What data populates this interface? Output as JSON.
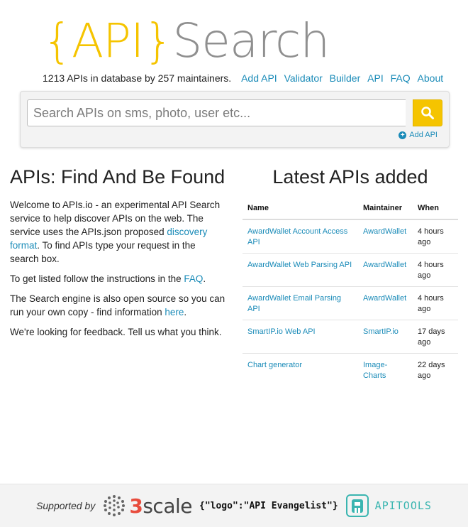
{
  "logo": {
    "brace_text": "{API}",
    "search_text": "Search"
  },
  "stats": {
    "text": "1213 APIs in database by 257 maintainers."
  },
  "nav": [
    {
      "label": "Add API"
    },
    {
      "label": "Validator"
    },
    {
      "label": "Builder"
    },
    {
      "label": "API"
    },
    {
      "label": "FAQ"
    },
    {
      "label": "About"
    }
  ],
  "search": {
    "placeholder": "Search APIs on sms, photo, user etc...",
    "value": "",
    "button_icon": "search-icon",
    "add_api_label": "Add API"
  },
  "intro": {
    "heading": "APIs: Find And Be Found",
    "p1_before": "Welcome to APIs.io - an experimental API Search service to help discover APIs on the web. The service uses the APIs.json proposed ",
    "p1_link": "discovery format",
    "p1_after": ". To find APIs type your request in the search box.",
    "p2_before": "To get listed follow the instructions in the ",
    "p2_link": "FAQ",
    "p2_after": ".",
    "p3_before": "The Search engine is also open source so you can run your own copy - find information ",
    "p3_link": "here",
    "p3_after": ".",
    "p4": "We're looking for feedback. Tell us what you think."
  },
  "latest": {
    "heading": "Latest APIs added",
    "columns": [
      "Name",
      "Maintainer",
      "When"
    ],
    "rows": [
      {
        "name": "AwardWallet Account Access API",
        "maintainer": "AwardWallet",
        "when": "4 hours ago"
      },
      {
        "name": "AwardWallet Web Parsing API",
        "maintainer": "AwardWallet",
        "when": "4 hours ago"
      },
      {
        "name": "AwardWallet Email Parsing API",
        "maintainer": "AwardWallet",
        "when": "4 hours ago"
      },
      {
        "name": "SmartIP.io Web API",
        "maintainer": "SmartIP.io",
        "when": "17 days ago"
      },
      {
        "name": "Chart generator",
        "maintainer": "Image-Charts",
        "when": "22 days ago"
      }
    ]
  },
  "footer": {
    "supported_by": "Supported by",
    "threescale_three": "3",
    "threescale_rest": "scale",
    "evangelist": "{\"logo\":\"API Evangelist\"}",
    "apitools": "APITOOLS"
  },
  "colors": {
    "accent_yellow": "#f5c400",
    "link_blue": "#1a8bb8",
    "logo_gray": "#8f8f8f",
    "threescale_red": "#e84c3d",
    "apitools_teal": "#3ab5b0"
  }
}
